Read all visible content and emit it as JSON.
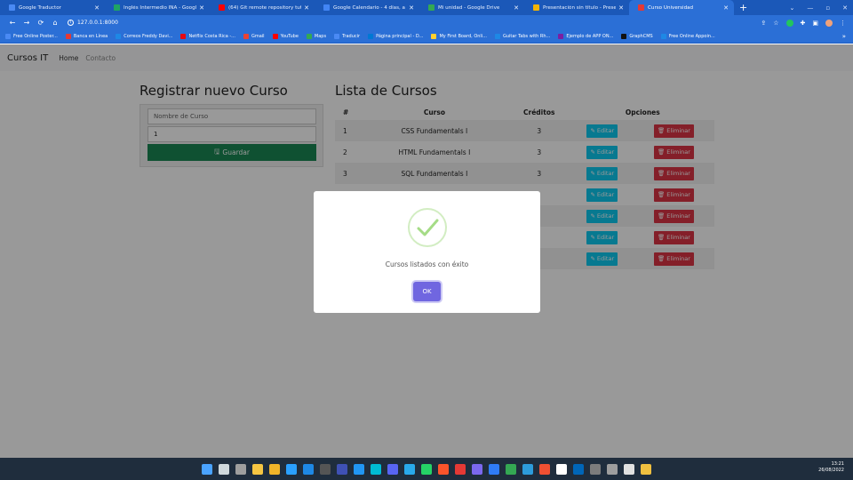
{
  "browser": {
    "tabs": [
      {
        "label": "Google Traductor",
        "color": "#4a8af4",
        "active": false
      },
      {
        "label": "Inglés Intermedio INA - Google",
        "color": "#1fa463",
        "active": false
      },
      {
        "label": "(64) Git remote repository tutor",
        "color": "#ff0000",
        "active": false
      },
      {
        "label": "Google Calendario - 4 días, a pa",
        "color": "#4285f4",
        "active": false
      },
      {
        "label": "Mi unidad - Google Drive",
        "color": "#34a853",
        "active": false
      },
      {
        "label": "Presentación sin título - Presen",
        "color": "#f4b400",
        "active": false
      },
      {
        "label": "Curso Universidad",
        "color": "#e53935",
        "active": true
      }
    ],
    "new_tab": "+",
    "url": "127.0.0.1:8000",
    "bookmarks": [
      {
        "label": "Free Online Poster...",
        "color": "#4a8af4"
      },
      {
        "label": "Banca en Línea",
        "color": "#e53935"
      },
      {
        "label": "Correos Freddy Davi...",
        "color": "#1e88e5"
      },
      {
        "label": "Netflix Costa Rica -...",
        "color": "#e50914"
      },
      {
        "label": "Gmail",
        "color": "#ea4335"
      },
      {
        "label": "YouTube",
        "color": "#ff0000"
      },
      {
        "label": "Maps",
        "color": "#34a853"
      },
      {
        "label": "Traducir",
        "color": "#4a8af4"
      },
      {
        "label": "Página principal - D...",
        "color": "#0078d4"
      },
      {
        "label": "My First Board, Onli...",
        "color": "#ffd02f"
      },
      {
        "label": "Guitar Tabs with Rh...",
        "color": "#1e88e5"
      },
      {
        "label": "Ejemplo de APP ON...",
        "color": "#7b1fa2"
      },
      {
        "label": "GraphCMS",
        "color": "#111111"
      },
      {
        "label": "Free Online Appoin...",
        "color": "#1e88e5"
      }
    ],
    "bookmarks_more": "»"
  },
  "navbar": {
    "brand": "Cursos IT",
    "links": [
      "Home",
      "Contacto"
    ]
  },
  "form": {
    "title": "Registrar nuevo Curso",
    "name_placeholder": "Nombre de Curso",
    "credits_value": "1",
    "save_label": "Guardar"
  },
  "list": {
    "title": "Lista de Cursos",
    "headers": {
      "num": "#",
      "course": "Curso",
      "credits": "Créditos",
      "options": "Opciones"
    },
    "rows": [
      {
        "num": "1",
        "course": "CSS Fundamentals I",
        "credits": "3"
      },
      {
        "num": "2",
        "course": "HTML Fundamentals I",
        "credits": "3"
      },
      {
        "num": "3",
        "course": "SQL Fundamentals I",
        "credits": "3"
      },
      {
        "num": "",
        "course": "",
        "credits": ""
      },
      {
        "num": "",
        "course": "",
        "credits": ""
      },
      {
        "num": "",
        "course": "",
        "credits": ""
      },
      {
        "num": "",
        "course": "",
        "credits": ""
      }
    ],
    "edit_label": "Editar",
    "delete_label": "Eliminar"
  },
  "modal": {
    "message": "Cursos listados con éxito",
    "ok_label": "OK",
    "icon": "success-check-icon"
  },
  "taskbar": {
    "time": "13:21",
    "date": "26/08/2022"
  },
  "colors": {
    "browser_tabbar": "#1b58b8",
    "browser_toolbar": "#2b6fd6",
    "save_button": "#198754",
    "edit_button": "#0dcaf0",
    "delete_button": "#dc3545",
    "ok_button": "#7066e0",
    "success_check": "#a5dc86"
  }
}
